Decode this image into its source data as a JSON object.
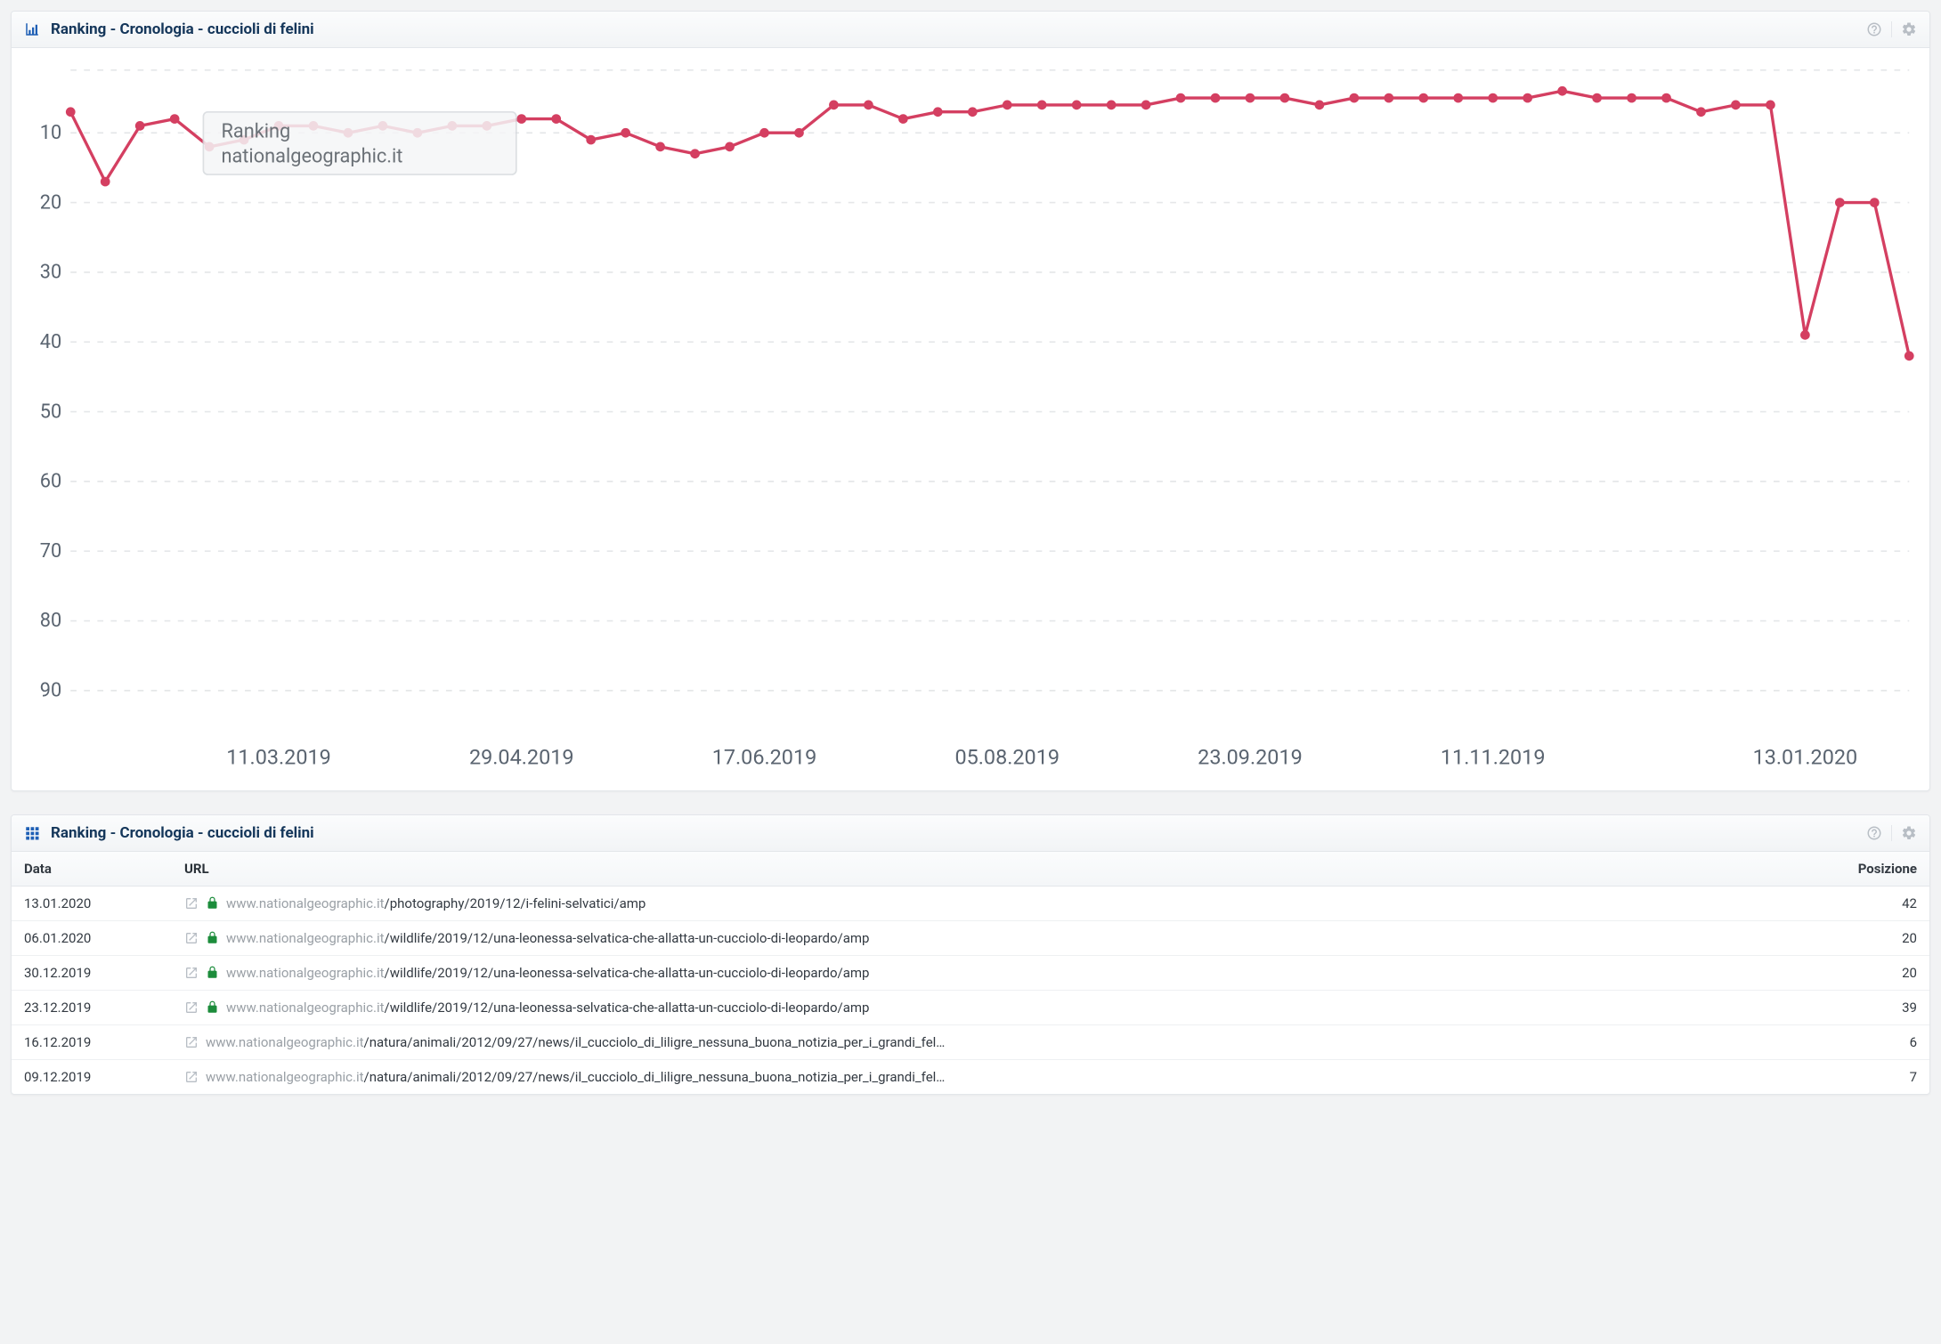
{
  "panel1": {
    "title": "Ranking - Cronologia - cuccioli di felini",
    "tooltip": {
      "line1": "Ranking",
      "line2": "nationalgeographic.it"
    }
  },
  "panel2": {
    "title": "Ranking - Cronologia - cuccioli di felini",
    "columns": {
      "date": "Data",
      "url": "URL",
      "pos": "Posizione"
    },
    "rows": [
      {
        "date": "13.01.2020",
        "https": true,
        "domain": "www.nationalgeographic.it",
        "path": "/photography/2019/12/i-felini-selvatici/amp",
        "pos": 42
      },
      {
        "date": "06.01.2020",
        "https": true,
        "domain": "www.nationalgeographic.it",
        "path": "/wildlife/2019/12/una-leonessa-selvatica-che-allatta-un-cucciolo-di-leopardo/amp",
        "pos": 20
      },
      {
        "date": "30.12.2019",
        "https": true,
        "domain": "www.nationalgeographic.it",
        "path": "/wildlife/2019/12/una-leonessa-selvatica-che-allatta-un-cucciolo-di-leopardo/amp",
        "pos": 20
      },
      {
        "date": "23.12.2019",
        "https": true,
        "domain": "www.nationalgeographic.it",
        "path": "/wildlife/2019/12/una-leonessa-selvatica-che-allatta-un-cucciolo-di-leopardo/amp",
        "pos": 39
      },
      {
        "date": "16.12.2019",
        "https": false,
        "domain": "www.nationalgeographic.it",
        "path": "/natura/animali/2012/09/27/news/il_cucciolo_di_liligre_nessuna_buona_notizia_per_i_grandi_fel…",
        "pos": 6
      },
      {
        "date": "09.12.2019",
        "https": false,
        "domain": "www.nationalgeographic.it",
        "path": "/natura/animali/2012/09/27/news/il_cucciolo_di_liligre_nessuna_buona_notizia_per_i_grandi_fel…",
        "pos": 7
      }
    ]
  },
  "chart_data": {
    "type": "line",
    "title": "Ranking - Cronologia - cuccioli di felini",
    "xlabel": "",
    "ylabel": "",
    "ylim_reversed": true,
    "ylim": [
      1,
      95
    ],
    "y_ticks": [
      10,
      20,
      30,
      40,
      50,
      60,
      70,
      80,
      90
    ],
    "x_tick_labels": [
      "11.03.2019",
      "29.04.2019",
      "17.06.2019",
      "05.08.2019",
      "23.09.2019",
      "11.11.2019",
      "13.01.2020"
    ],
    "x_tick_positions": [
      6,
      13,
      20,
      27,
      34,
      41,
      50
    ],
    "series": [
      {
        "name": "nationalgeographic.it",
        "color": "#d43f61",
        "values": [
          7,
          17,
          9,
          8,
          12,
          11,
          9,
          9,
          10,
          9,
          10,
          9,
          9,
          8,
          8,
          11,
          10,
          12,
          13,
          12,
          10,
          10,
          6,
          6,
          8,
          7,
          7,
          6,
          6,
          6,
          6,
          6,
          5,
          5,
          5,
          5,
          6,
          5,
          5,
          5,
          5,
          5,
          5,
          4,
          5,
          5,
          5,
          7,
          6,
          6,
          39,
          20,
          20,
          42
        ]
      }
    ]
  }
}
